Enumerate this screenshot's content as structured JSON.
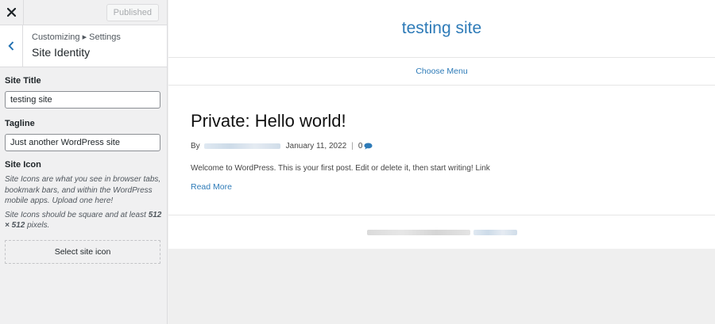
{
  "sidebar": {
    "published_label": "Published",
    "breadcrumb": "Customizing ▸ Settings",
    "section_title": "Site Identity",
    "site_title_label": "Site Title",
    "site_title_value": "testing site",
    "tagline_label": "Tagline",
    "tagline_value": "Just another WordPress site",
    "site_icon_label": "Site Icon",
    "site_icon_desc": "Site Icons are what you see in browser tabs, bookmark bars, and within the WordPress mobile apps. Upload one here!",
    "site_icon_size_prefix": "Site Icons should be square and at least ",
    "site_icon_size_value": "512 × 512",
    "site_icon_size_suffix": " pixels.",
    "select_icon_label": "Select site icon"
  },
  "preview": {
    "site_title": "testing site",
    "nav_label": "Choose Menu",
    "post": {
      "title": "Private: Hello world!",
      "by_label": "By",
      "date": "January 11, 2022",
      "separator": "|",
      "comment_count": "0",
      "excerpt": "Welcome to WordPress. This is your first post. Edit or delete it, then start writing! Link",
      "read_more": "Read More"
    }
  },
  "icons": {
    "close": "close-icon",
    "back": "chevron-left-icon",
    "comment": "comment-icon"
  },
  "colors": {
    "link": "#2e7bb8",
    "sidebar_bg": "#f0f0f1",
    "preview_bg": "#efefef"
  }
}
